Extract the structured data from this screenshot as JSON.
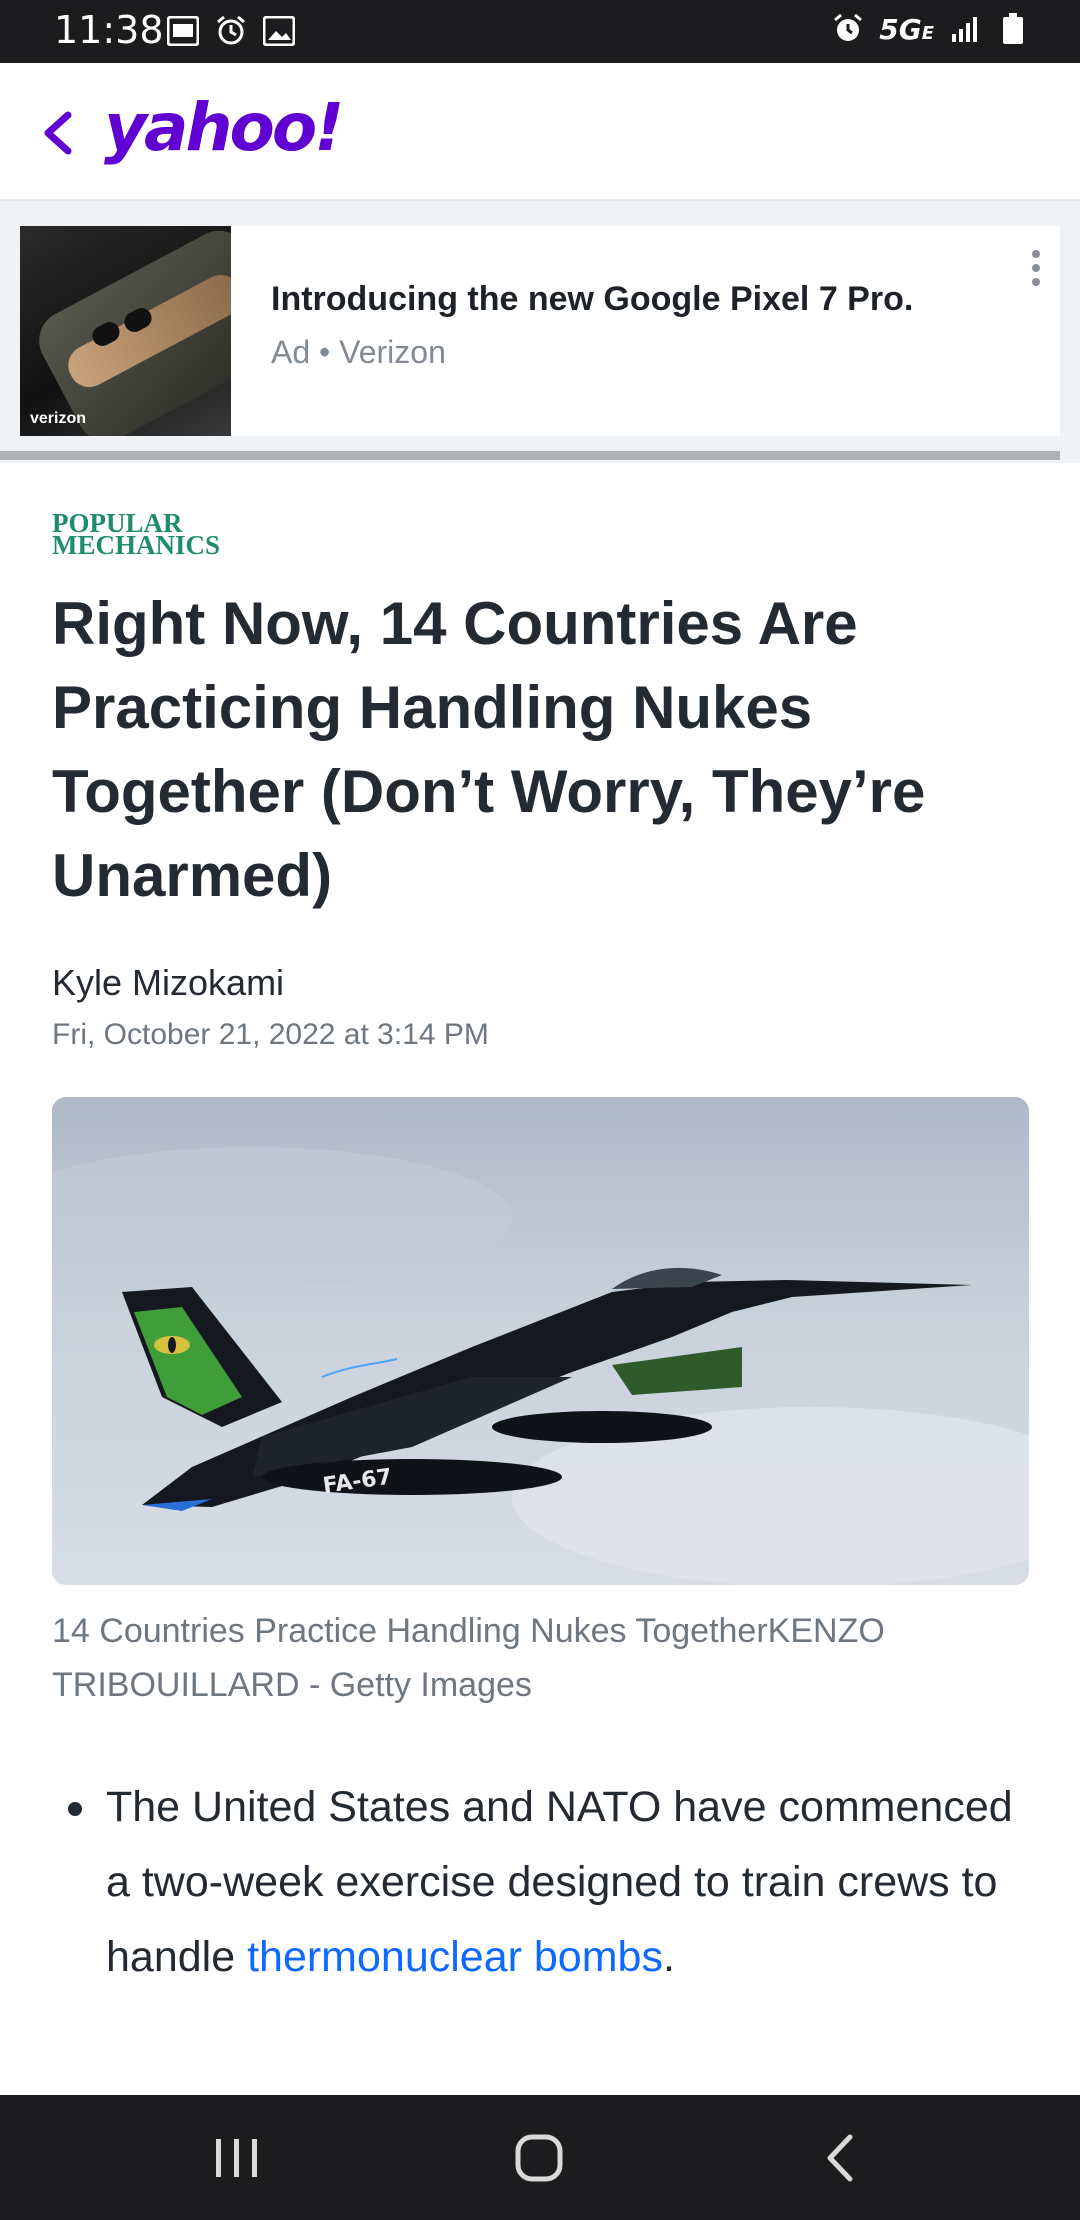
{
  "status_bar": {
    "time": "11:38",
    "network": "5G",
    "network_suffix": "E"
  },
  "header": {
    "logo": "yahoo!",
    "colors": {
      "brand": "#6001d2"
    }
  },
  "ad": {
    "image_brand": "verizon",
    "title": "Introducing the new Google Pixel 7 Pro.",
    "meta": "Ad • Verizon"
  },
  "article": {
    "publisher_line1": "POPULAR",
    "publisher_line2": "MECHANICS",
    "headline": "Right Now, 14 Countries Are Practicing Handling Nukes Together (Don’t Worry, They’re Unarmed)",
    "author": "Kyle Mizokami",
    "date": "Fri, October 21, 2022 at 3:14 PM",
    "image_caption": "14 Countries Practice Handling Nukes TogetherKENZO TRIBOUILLARD - Getty Images",
    "bullets": [
      {
        "text_before": "The United States and NATO have commenced a two-week exercise designed to train crews to handle ",
        "link_text": "thermonuclear bombs",
        "text_after": "."
      }
    ],
    "jet_tail_marking": "FA-67"
  }
}
